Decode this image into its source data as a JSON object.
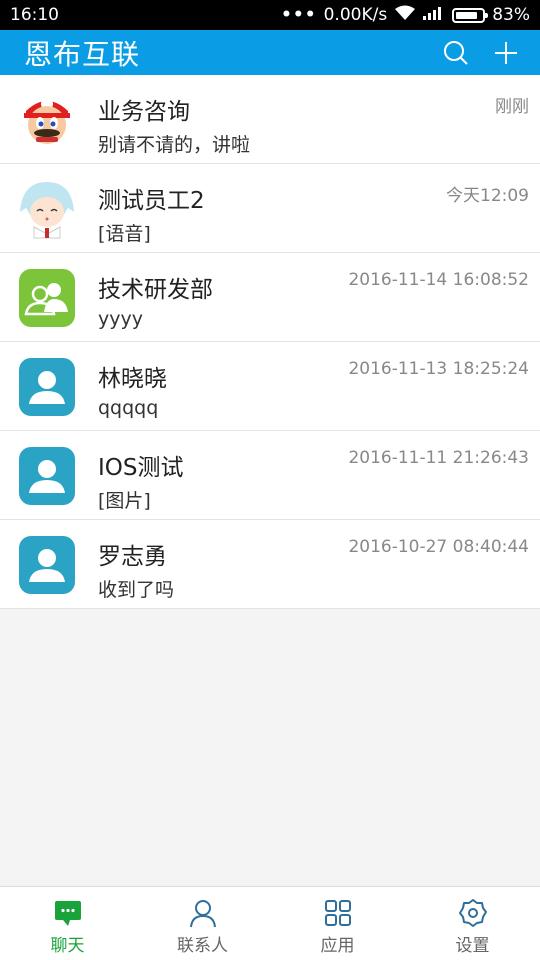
{
  "status_bar": {
    "time": "16:10",
    "network_speed": "0.00K/s",
    "battery_percent": "83%",
    "battery_level": 0.83,
    "icons": [
      "dots-icon",
      "wifi-icon",
      "signal-icon",
      "battery-icon"
    ]
  },
  "app_bar": {
    "title": "恩布互联",
    "actions": [
      "search-icon",
      "plus-icon"
    ],
    "color": "#0a9de6"
  },
  "chats": [
    {
      "name": "业务咨询",
      "time": "刚刚",
      "message": "别请不请的，讲啦",
      "avatar": "mario-avatar"
    },
    {
      "name": "测试员工2",
      "time": "今天12:09",
      "message": "[语音]",
      "avatar": "anime-avatar"
    },
    {
      "name": "技术研发部",
      "time": "2016-11-14 16:08:52",
      "message": "yyyy",
      "avatar": "group-avatar"
    },
    {
      "name": "林晓晓",
      "time": "2016-11-13 18:25:24",
      "message": "qqqqq",
      "avatar": "person-avatar"
    },
    {
      "name": "IOS测试",
      "time": "2016-11-11 21:26:43",
      "message": "[图片]",
      "avatar": "person-avatar"
    },
    {
      "name": "罗志勇",
      "time": "2016-10-27 08:40:44",
      "message": "收到了吗",
      "avatar": "person-avatar"
    }
  ],
  "tabs": [
    {
      "label": "聊天",
      "icon": "chat-icon",
      "active": true
    },
    {
      "label": "联系人",
      "icon": "contacts-icon",
      "active": false
    },
    {
      "label": "应用",
      "icon": "apps-icon",
      "active": false
    },
    {
      "label": "设置",
      "icon": "settings-icon",
      "active": false
    }
  ],
  "colors": {
    "active_tab": "#1aa33a",
    "group_avatar": "#7cc43a",
    "person_avatar": "#2aa3c4"
  }
}
